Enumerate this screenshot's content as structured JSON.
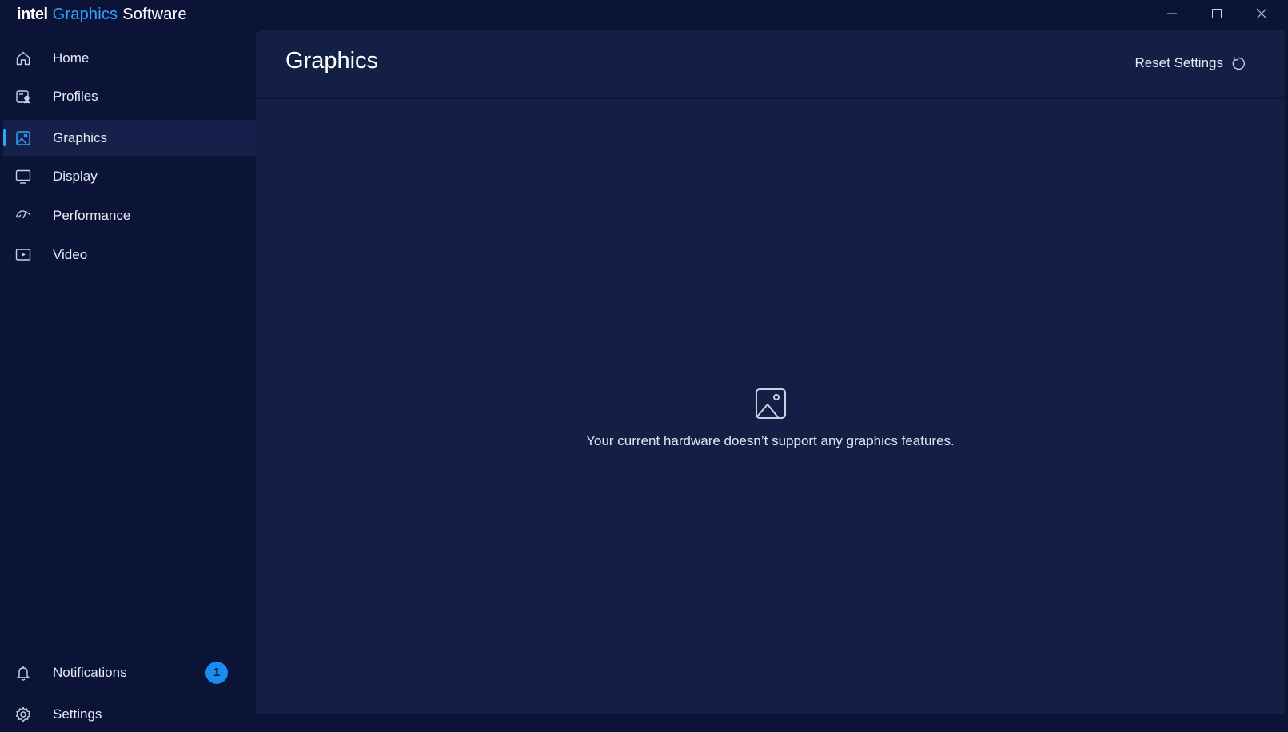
{
  "app": {
    "brand_intel": "intel",
    "brand_graphics": "Graphics",
    "brand_software": "Software"
  },
  "window_controls": {
    "minimize_icon": "minimize-icon",
    "maximize_icon": "maximize-icon",
    "close_icon": "close-icon"
  },
  "sidebar": {
    "items": [
      {
        "label": "Home",
        "icon": "home-icon"
      },
      {
        "label": "Profiles",
        "icon": "profiles-icon"
      },
      {
        "label": "Graphics",
        "icon": "image-icon",
        "active": true
      },
      {
        "label": "Display",
        "icon": "monitor-icon"
      },
      {
        "label": "Performance",
        "icon": "gauge-icon"
      },
      {
        "label": "Video",
        "icon": "play-icon"
      }
    ],
    "footer": [
      {
        "label": "Notifications",
        "icon": "bell-icon",
        "badge": "1"
      },
      {
        "label": "Settings",
        "icon": "gear-icon"
      }
    ]
  },
  "main": {
    "title": "Graphics",
    "reset_label": "Reset Settings",
    "empty_message": "Your current hardware doesn’t support any graphics features."
  },
  "colors": {
    "background": "#0b1337",
    "panel": "#131f45",
    "accent": "#2aa6ff",
    "badge": "#1a8cf0"
  }
}
